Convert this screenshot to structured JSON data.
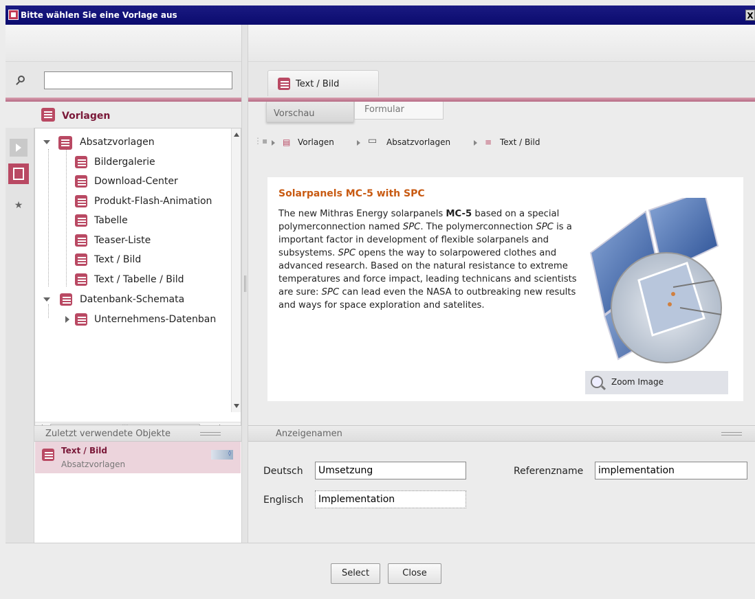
{
  "window": {
    "title": "Bitte wählen Sie eine Vorlage aus",
    "close": "X"
  },
  "left": {
    "search": {
      "value": "",
      "placeholder": ""
    },
    "section_title": "Vorlagen",
    "tree": {
      "group1": {
        "label": "Absatzvorlagen",
        "items": [
          "Bildergalerie",
          "Download-Center",
          "Produkt-Flash-Animation",
          "Tabelle",
          "Teaser-Liste",
          "Text / Bild",
          "Text / Tabelle / Bild"
        ]
      },
      "group2": {
        "label": "Datenbank-Schemata",
        "items": [
          "Unternehmens-Datenban"
        ]
      }
    },
    "recent": {
      "title": "Zuletzt verwendete Objekte",
      "item_title": "Text / Bild",
      "item_subtitle": "Absatzvorlagen"
    }
  },
  "right": {
    "tab": "Text / Bild",
    "subtabs": {
      "preview": "Vorschau",
      "form": "Formular"
    },
    "breadcrumb": [
      "Vorlagen",
      "Absatzvorlagen",
      "Text / Bild"
    ],
    "preview": {
      "title": "Solarpanels MC-5 with SPC",
      "zoom": "Zoom Image"
    },
    "names": {
      "title": "Anzeigenamen",
      "deutsch_label": "Deutsch",
      "deutsch_value": "Umsetzung",
      "englisch_label": "Englisch",
      "englisch_value": "Implementation",
      "ref_label": "Referenzname",
      "ref_value": "implementation"
    }
  },
  "buttons": {
    "select": "Select",
    "close": "Close"
  },
  "colors": {
    "accent": "#b94963",
    "title_bar": "#0b0b6e",
    "preview_title": "#c85a12"
  }
}
